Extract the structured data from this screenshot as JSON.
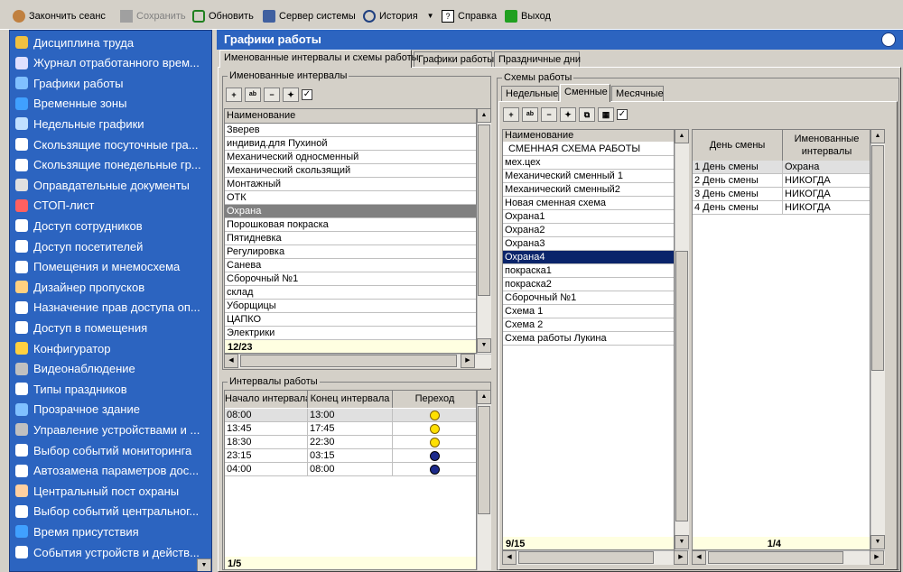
{
  "toolbar": {
    "end_session": "Закончить сеанс",
    "save": "Сохранить",
    "refresh": "Обновить",
    "server": "Сервер системы",
    "history": "История",
    "help": "Справка",
    "exit": "Выход"
  },
  "sidebar": {
    "items": [
      "Дисциплина труда",
      "Журнал отработанного врем...",
      "Графики работы",
      "Временные зоны",
      "Недельные графики",
      "Скользящие посуточные гра...",
      "Скользящие понедельные гр...",
      "Оправдательные документы",
      "СТОП-лист",
      "Доступ сотрудников",
      "Доступ посетителей",
      "Помещения и мнемосхема",
      "Дизайнер пропусков",
      "Назначение прав доступа оп...",
      "Доступ в помещения",
      "Конфигуратор",
      "Видеонаблюдение",
      "Типы праздников",
      "Прозрачное здание",
      "Управление устройствами и ...",
      "Выбор событий мониторинга",
      "Автозамена параметров дос...",
      "Центральный пост охраны",
      "Выбор событий центральног...",
      "Время присутствия",
      "События устройств и действ..."
    ]
  },
  "header": {
    "title": "Графики работы"
  },
  "tabs": [
    "Именованные интервалы и схемы работы",
    "Графики работы",
    "Праздничные дни"
  ],
  "named_intervals": {
    "group": "Именованные интервалы",
    "column": "Наименование",
    "rows": [
      "Зверев",
      "индивид.для Пухиной",
      "Механический односменный",
      "Механический скользящий",
      "Монтажный",
      "ОТК",
      "Охрана",
      "Порошковая покраска",
      "Пятидневка",
      "Регулировка",
      "Санева",
      "Сборочный №1",
      "склад",
      "Уборщицы",
      "ЦАПКО",
      "Электрики"
    ],
    "selected_index": 6,
    "footer": "12/23"
  },
  "work_intervals": {
    "group": "Интервалы работы",
    "columns": [
      "Начало интервала",
      "Конец интервала",
      "Переход"
    ],
    "rows": [
      {
        "start": "08:00",
        "end": "13:00",
        "icon": "day-clock-icon"
      },
      {
        "start": "13:45",
        "end": "17:45",
        "icon": "day-clock-icon"
      },
      {
        "start": "18:30",
        "end": "22:30",
        "icon": "day-clock-icon"
      },
      {
        "start": "23:15",
        "end": "03:15",
        "icon": "night-clock-icon"
      },
      {
        "start": "04:00",
        "end": "08:00",
        "icon": "night-clock-icon"
      }
    ],
    "footer": "1/5"
  },
  "schemes": {
    "group": "Схемы работы",
    "subtabs": [
      "Недельные",
      "Сменные",
      "Месячные"
    ],
    "column": "Наименование",
    "rows": [
      "СМЕННАЯ СХЕМА РАБОТЫ",
      "мех.цех",
      "Механический сменный 1",
      "Механический сменный2",
      "Новая сменная схема",
      "Охрана1",
      "Охрана2",
      "Охрана3",
      "Охрана4",
      "покраска1",
      "покраска2",
      "Сборочный №1",
      "Схема 1",
      "Схема 2",
      "Схема работы Лукина"
    ],
    "selected_index": 8,
    "footer": "9/15"
  },
  "shift_days": {
    "columns": [
      "День смены",
      "Именованные интервалы"
    ],
    "rows": [
      {
        "day": "1 День смены",
        "interval": "Охрана"
      },
      {
        "day": "2 День смены",
        "interval": "НИКОГДА"
      },
      {
        "day": "3 День смены",
        "interval": "НИКОГДА"
      },
      {
        "day": "4 День смены",
        "interval": "НИКОГДА"
      }
    ],
    "footer": "1/4"
  },
  "colors": {
    "sidebar": "#2c64c0",
    "selection": "#0a246a"
  }
}
